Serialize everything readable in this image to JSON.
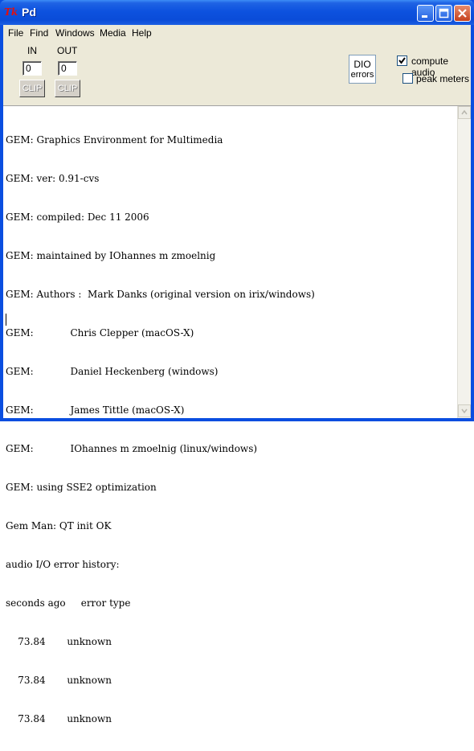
{
  "window": {
    "title": "Pd",
    "icon_text": "Tk"
  },
  "menu": [
    "File",
    "Find",
    "Windows",
    "Media",
    "Help"
  ],
  "audio": {
    "in_label": "IN",
    "out_label": "OUT",
    "in_value": "0",
    "out_value": "0",
    "clip_in": "CLIP",
    "clip_out": "CLIP",
    "dio_label": "DIO",
    "dio_sub": "errors",
    "compute_audio_label": "compute audio",
    "compute_audio_checked": true,
    "peak_meters_label": "peak meters",
    "peak_meters_checked": false
  },
  "console": {
    "lines": [
      "GEM: Graphics Environment for Multimedia",
      "GEM: ver: 0.91-cvs",
      "GEM: compiled: Dec 11 2006",
      "GEM: maintained by IOhannes m zmoelnig",
      "GEM: Authors :  Mark Danks (original version on irix/windows)",
      "GEM:            Chris Clepper (macOS-X)",
      "GEM:            Daniel Heckenberg (windows)",
      "GEM:            James Tittle (macOS-X)",
      "GEM:            IOhannes m zmoelnig (linux/windows)",
      "GEM: using SSE2 optimization",
      "Gem Man: QT init OK",
      "audio I/O error history:",
      "seconds ago     error type",
      "    73.84       unknown",
      "    73.84       unknown",
      "    73.84       unknown"
    ]
  },
  "colors": {
    "titlebar": "#0a4cd8",
    "panel": "#ece9d8",
    "close": "#c5401c"
  },
  "icons": [
    "minimize-icon",
    "maximize-icon",
    "close-icon",
    "checkmark-icon",
    "scroll-up-icon",
    "scroll-down-icon"
  ]
}
